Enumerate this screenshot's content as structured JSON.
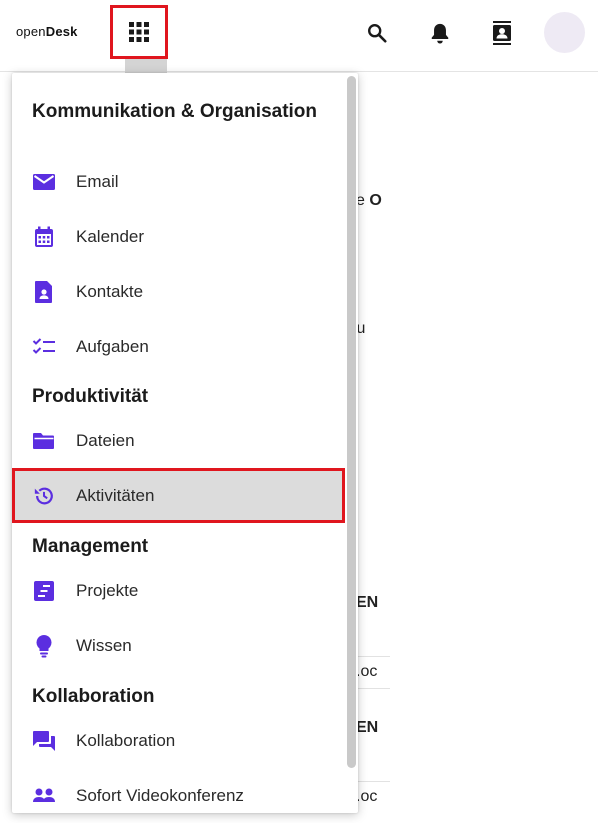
{
  "header": {
    "logo_prefix": "open",
    "logo_strong": "Desk"
  },
  "background": {
    "frag1": "e",
    "frag1b": "O",
    "frag2": "tzu",
    "frag3": "EN",
    "frag4": ".oc",
    "frag5": "EN",
    "frag6": ".oc"
  },
  "menu": {
    "sections": [
      {
        "title": "Kommunikation & Organisation"
      },
      {
        "title": "Produktivität"
      },
      {
        "title": "Management"
      },
      {
        "title": "Kollaboration"
      }
    ],
    "items": [
      {
        "label": "Email",
        "icon": "mail-icon"
      },
      {
        "label": "Kalender",
        "icon": "calendar-icon"
      },
      {
        "label": "Kontakte",
        "icon": "contact-card-icon"
      },
      {
        "label": "Aufgaben",
        "icon": "checklist-icon"
      },
      {
        "label": "Dateien",
        "icon": "folder-icon"
      },
      {
        "label": "Aktivitäten",
        "icon": "history-icon"
      },
      {
        "label": "Projekte",
        "icon": "project-icon"
      },
      {
        "label": "Wissen",
        "icon": "lightbulb-icon"
      },
      {
        "label": "Kollaboration",
        "icon": "chat-icon"
      },
      {
        "label": "Sofort Videokonferenz",
        "icon": "video-people-icon"
      }
    ]
  },
  "colors": {
    "accent": "#5b2ee0",
    "highlight_border": "#e0161e"
  }
}
